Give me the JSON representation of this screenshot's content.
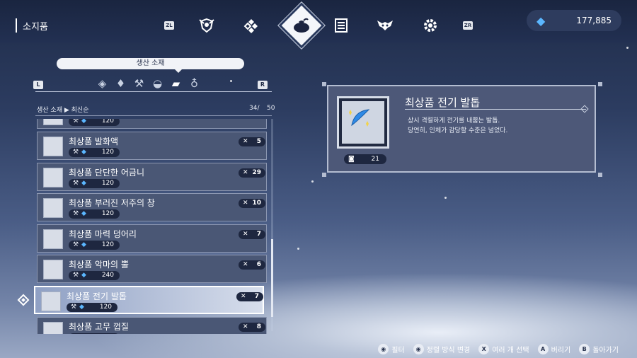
{
  "header": {
    "title": "소지품",
    "zl_label": "ZL",
    "zr_label": "ZR",
    "currency_amount": "177,885"
  },
  "category": {
    "label": "생산 소재",
    "l_label": "L",
    "r_label": "R",
    "icons": [
      "diamond-stack-icon",
      "gem-icon",
      "bone-icon",
      "mortar-icon",
      "fabric-icon",
      "potion-icon"
    ]
  },
  "sort": {
    "category": "생산 소재",
    "order": "최신순",
    "count": "34/",
    "total": "50"
  },
  "items": [
    {
      "name": "",
      "level": "120",
      "qty": ""
    },
    {
      "name": "최상품 발화액",
      "level": "120",
      "qty": "5"
    },
    {
      "name": "최상품 단단한 어금니",
      "level": "120",
      "qty": "29"
    },
    {
      "name": "최상품 부러진 저주의 창",
      "level": "120",
      "qty": "10"
    },
    {
      "name": "최상품 마력 덩어리",
      "level": "120",
      "qty": "7"
    },
    {
      "name": "최상품 악마의 뿔",
      "level": "240",
      "qty": "6"
    },
    {
      "name": "최상품 전기 발톱",
      "level": "120",
      "qty": "7"
    },
    {
      "name": "최상품 고무 껍질",
      "level": "120",
      "qty": "8"
    }
  ],
  "detail": {
    "name": "최상품 전기 발톱",
    "desc_line1": "상시 격렬하게 전기를 내뿜는 발톱.",
    "desc_line2": "당연히, 인체가 감당할 수준은 넘었다.",
    "qty": "21"
  },
  "hints": [
    {
      "key": "",
      "label": "필터"
    },
    {
      "key": "",
      "label": "정렬 방식 변경"
    },
    {
      "key": "X",
      "label": "여러 개 선택"
    },
    {
      "key": "A",
      "label": "버리기"
    },
    {
      "key": "B",
      "label": "돌아가기"
    }
  ],
  "colors": {
    "accent_gem": "#5bb7ff",
    "panel": "#4a5775",
    "selected_border": "#ffffff"
  }
}
